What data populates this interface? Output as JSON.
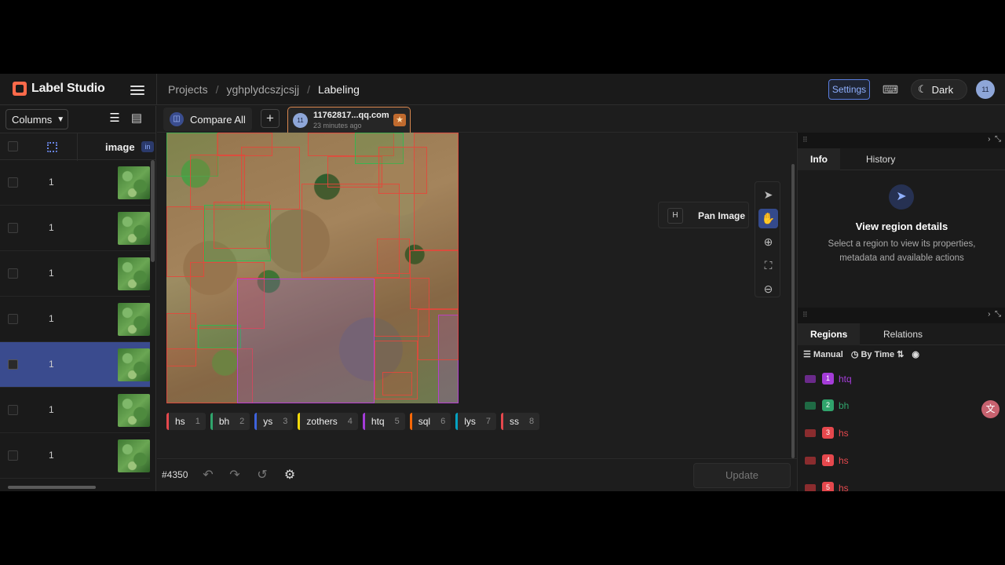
{
  "app": {
    "name": "Label Studio"
  },
  "breadcrumb": {
    "projects": "Projects",
    "project": "yghplydcszjcsjj",
    "current": "Labeling",
    "separator": "/"
  },
  "topbar": {
    "settings": "Settings",
    "theme": "Dark",
    "avatar": "11"
  },
  "left_panel": {
    "columns_label": "Columns",
    "header": {
      "image": "image",
      "badge": "in"
    },
    "rows": [
      {
        "value": "1",
        "selected": false
      },
      {
        "value": "1",
        "selected": false
      },
      {
        "value": "1",
        "selected": false
      },
      {
        "value": "1",
        "selected": false
      },
      {
        "value": "1",
        "selected": true
      },
      {
        "value": "1",
        "selected": false
      },
      {
        "value": "1",
        "selected": false
      }
    ]
  },
  "tabs": {
    "compare_all": "Compare All",
    "add": "+",
    "annotation": {
      "avatar": "11",
      "title": "11762817...qq.com",
      "time": "23 minutes ago"
    }
  },
  "tooltip": {
    "key": "H",
    "text": "Pan Image"
  },
  "labels": [
    {
      "name": "hs",
      "key": "1",
      "color": "#e5484d"
    },
    {
      "name": "bh",
      "key": "2",
      "color": "#30a46c"
    },
    {
      "name": "ys",
      "key": "3",
      "color": "#3e63dd"
    },
    {
      "name": "zothers",
      "key": "4",
      "color": "#f5d90a"
    },
    {
      "name": "htq",
      "key": "5",
      "color": "#a43cd8"
    },
    {
      "name": "sql",
      "key": "6",
      "color": "#f76808"
    },
    {
      "name": "lys",
      "key": "7",
      "color": "#05a2c2"
    },
    {
      "name": "ss",
      "key": "8",
      "color": "#e5484d"
    }
  ],
  "bottom": {
    "task_id": "#4350",
    "update": "Update"
  },
  "info_panel": {
    "tabs": [
      "Info",
      "History"
    ],
    "title": "View region details",
    "description": "Select a region to view its properties, metadata and available actions"
  },
  "regions_panel": {
    "tabs": [
      "Regions",
      "Relations"
    ],
    "sort_mode": "Manual",
    "sort_by": "By Time",
    "items": [
      {
        "index": "1",
        "label": "htq",
        "color": "#a43cd8"
      },
      {
        "index": "2",
        "label": "bh",
        "color": "#30a46c"
      },
      {
        "index": "3",
        "label": "hs",
        "color": "#e5484d"
      },
      {
        "index": "4",
        "label": "hs",
        "color": "#e5484d"
      },
      {
        "index": "5",
        "label": "hs",
        "color": "#e5484d"
      }
    ]
  }
}
